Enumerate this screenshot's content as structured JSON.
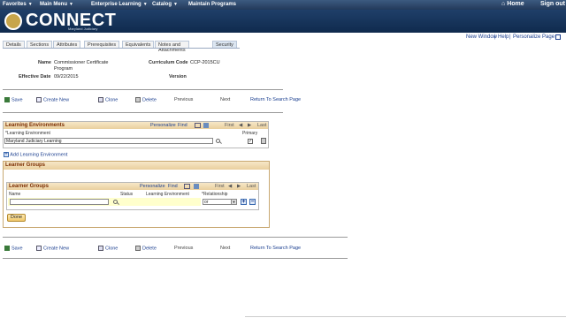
{
  "topbar": {
    "menus": [
      "Favorites",
      "Main Menu",
      "Enterprise Learning",
      "Catalog",
      "Maintain Programs"
    ],
    "home": "Home",
    "signout": "Sign out"
  },
  "brand": {
    "name": "CONNECT",
    "sub": "Maryland Judiciary"
  },
  "links": {
    "new_window": "New Window",
    "help": "Help",
    "personalize": "Personalize Page"
  },
  "tabs": [
    "Details",
    "Sections",
    "Attributes",
    "Prerequisites",
    "Equivalents",
    "Notes and Attachments",
    "Security"
  ],
  "active_tab": "Security",
  "fields": {
    "name_label": "Name",
    "name_value_1": "Commissioner Certificate",
    "name_value_2": "Program",
    "code_label": "Curriculum Code",
    "code_value": "CCP-2015CU",
    "eff_label": "Effective Date",
    "eff_value": "09/22/2015",
    "version_label": "Version",
    "version_value": ""
  },
  "toolbar": {
    "save": "Save",
    "create_new": "Create New",
    "clone": "Clone",
    "delete": "Delete",
    "previous": "Previous",
    "next": "Next",
    "return": "Return To Search Page"
  },
  "learning_env": {
    "title": "Learning Environments",
    "personalize": "Personalize",
    "find": "Find",
    "first": "First",
    "last": "Last",
    "col_env": "*Learning Environment",
    "col_primary": "Primary",
    "row_value": "Maryland Judiciary Learning",
    "primary_checked": "✓",
    "add_label": "Add Learning Environment"
  },
  "learner_groups_outer": {
    "title": "Learner Groups"
  },
  "learner_groups": {
    "title": "Learner Groups",
    "personalize": "Personalize",
    "find": "Find",
    "first": "First",
    "last": "Last",
    "col_name": "Name",
    "col_status": "Status",
    "col_env": "Learning Environment",
    "col_rel": "*Relationship",
    "name_value": "",
    "relationship": "or",
    "done": "Done"
  }
}
